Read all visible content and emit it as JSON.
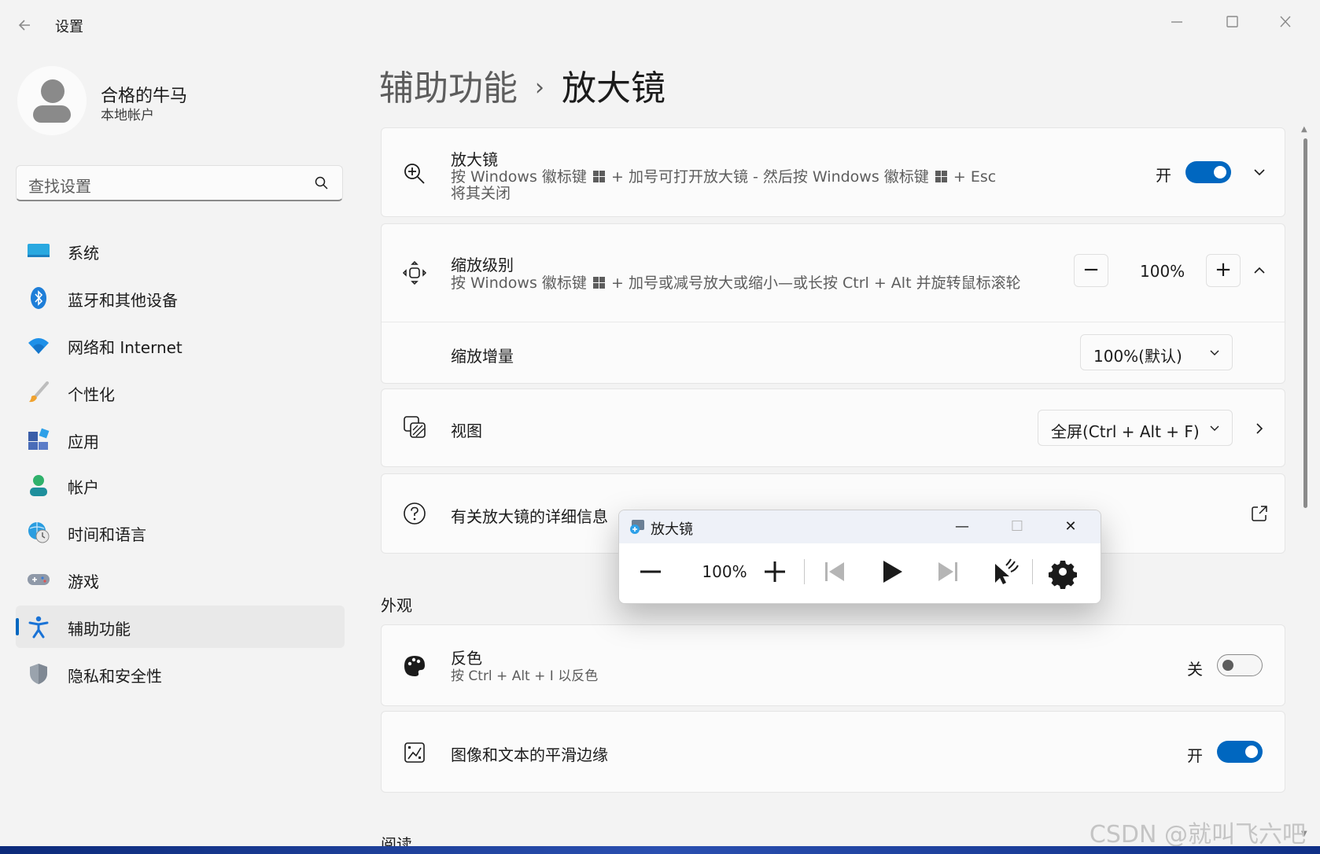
{
  "window": {
    "app_title": "设置",
    "back_icon": "back-arrow-icon",
    "controls": [
      "minimize-icon",
      "maximize-icon",
      "close-icon"
    ]
  },
  "user": {
    "name": "合格的牛马",
    "account_type": "本地帐户"
  },
  "search": {
    "placeholder": "查找设置",
    "icon": "search-icon"
  },
  "nav": {
    "items": [
      {
        "label": "系统",
        "icon": "system-icon"
      },
      {
        "label": "蓝牙和其他设备",
        "icon": "bluetooth-icon"
      },
      {
        "label": "网络和 Internet",
        "icon": "wifi-icon"
      },
      {
        "label": "个性化",
        "icon": "brush-icon"
      },
      {
        "label": "应用",
        "icon": "apps-icon"
      },
      {
        "label": "帐户",
        "icon": "account-icon"
      },
      {
        "label": "时间和语言",
        "icon": "time-language-icon"
      },
      {
        "label": "游戏",
        "icon": "gamepad-icon"
      },
      {
        "label": "辅助功能",
        "icon": "accessibility-icon",
        "active": true
      },
      {
        "label": "隐私和安全性",
        "icon": "shield-icon"
      }
    ]
  },
  "breadcrumb": {
    "parent": "辅助功能",
    "separator": "›",
    "current": "放大镜"
  },
  "magnifier": {
    "title": "放大镜",
    "desc_line1_a": "按 Windows 徽标键",
    "desc_line1_b": "+ 加号可打开放大镜 - 然后按 Windows 徽标键",
    "desc_line1_c": "+ Esc",
    "desc_line2": "将其关闭",
    "toggle_label": "开",
    "toggle_on": true
  },
  "zoom_level": {
    "title": "缩放级别",
    "desc_a": "按 Windows 徽标键",
    "desc_b": "+ 加号或减号放大或缩小—或长按 Ctrl + Alt 并旋转鼠标滚轮",
    "minus": "−",
    "value": "100%",
    "plus": "+"
  },
  "zoom_increment": {
    "title": "缩放增量",
    "value": "100%(默认)"
  },
  "view": {
    "title": "视图",
    "value": "全屏(Ctrl + Alt + F)"
  },
  "more_info": {
    "title": "有关放大镜的详细信息"
  },
  "appearance": {
    "heading": "外观"
  },
  "invert": {
    "title": "反色",
    "desc": "按 Ctrl + Alt + I 以反色",
    "toggle_label": "关",
    "toggle_on": false
  },
  "smooth": {
    "title": "图像和文本的平滑边缘",
    "toggle_label": "开",
    "toggle_on": true
  },
  "reading": {
    "heading": "阅读"
  },
  "mag_window": {
    "title": "放大镜",
    "minimize": "—",
    "maximize": "☐",
    "close": "✕",
    "zoom_value": "100%"
  },
  "watermark": "CSDN @就叫飞六吧",
  "colors": {
    "accent": "#0067c0",
    "window_bg": "#f3f3f3",
    "card_bg": "#fbfbfb"
  }
}
